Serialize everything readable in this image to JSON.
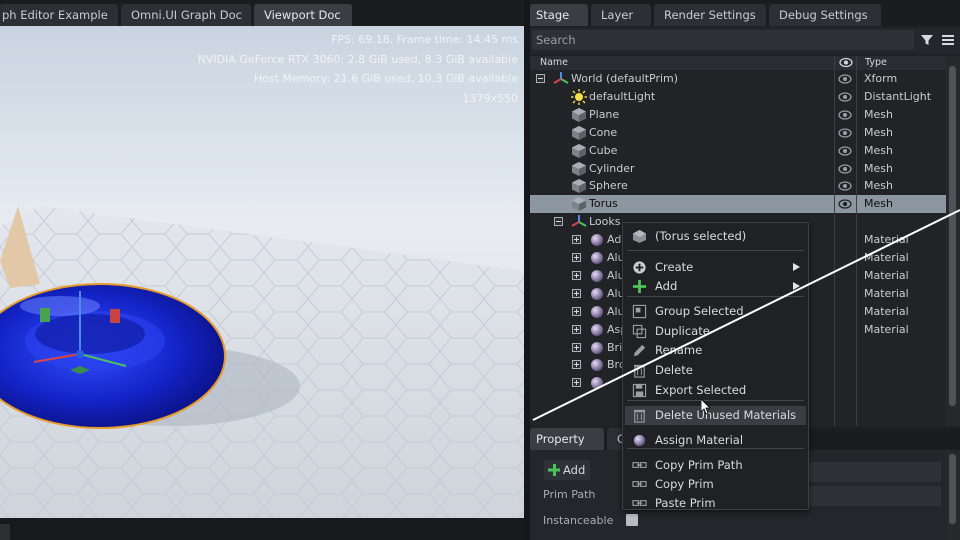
{
  "left_tabs": [
    "ph Editor Example",
    "Omni.UI Graph Doc",
    "Viewport Doc"
  ],
  "viewport": {
    "fps": "FPS: 69.18, Frame time: 14.45 ms",
    "gpu": "NVIDIA GeForce RTX 3060: 2.8 GiB used,  8.3 GiB available",
    "host": "Host Memory: 21.6 GiB used, 10.3 GiB available",
    "resolution": "1379x550"
  },
  "right_tabs": [
    "Stage",
    "Layer",
    "Render Settings",
    "Debug Settings"
  ],
  "search": {
    "placeholder": "Search"
  },
  "columns": {
    "name": "Name",
    "type": "Type"
  },
  "tree": [
    {
      "name": "World (defaultPrim)",
      "type": "Xform",
      "icon": "xform-icon",
      "indent": 0,
      "expander": "minus"
    },
    {
      "name": "defaultLight",
      "type": "DistantLight",
      "icon": "light-icon",
      "indent": 1
    },
    {
      "name": "Plane",
      "type": "Mesh",
      "icon": "mesh-icon",
      "indent": 1
    },
    {
      "name": "Cone",
      "type": "Mesh",
      "icon": "mesh-icon",
      "indent": 1
    },
    {
      "name": "Cube",
      "type": "Mesh",
      "icon": "mesh-icon",
      "indent": 1
    },
    {
      "name": "Cylinder",
      "type": "Mesh",
      "icon": "mesh-icon",
      "indent": 1
    },
    {
      "name": "Sphere",
      "type": "Mesh",
      "icon": "mesh-icon",
      "indent": 1
    },
    {
      "name": "Torus",
      "type": "Mesh",
      "icon": "mesh-icon",
      "indent": 1,
      "selected": true
    },
    {
      "name": "Looks",
      "type": "",
      "icon": "xform-icon",
      "indent": 1,
      "expander": "minus"
    },
    {
      "name": "Add",
      "type": "Material",
      "icon": "material-icon",
      "indent": 2,
      "expander": "plus"
    },
    {
      "name": "Alu",
      "type": "Material",
      "icon": "material-icon",
      "indent": 2,
      "expander": "plus"
    },
    {
      "name": "Alu",
      "type": "Material",
      "icon": "material-icon",
      "indent": 2,
      "expander": "plus"
    },
    {
      "name": "Alu",
      "type": "Material",
      "icon": "material-icon",
      "indent": 2,
      "expander": "plus"
    },
    {
      "name": "Alu",
      "type": "Material",
      "icon": "material-icon",
      "indent": 2,
      "expander": "plus"
    },
    {
      "name": "Asp",
      "type": "Material",
      "icon": "material-icon",
      "indent": 2,
      "expander": "plus"
    },
    {
      "name": "Bri",
      "type": "",
      "icon": "material-icon",
      "indent": 2,
      "expander": "plus"
    },
    {
      "name": "Bro",
      "type": "",
      "icon": "material-icon",
      "indent": 2,
      "expander": "plus"
    },
    {
      "name": "",
      "type": "",
      "icon": "material-icon",
      "indent": 2,
      "expander": "plus"
    }
  ],
  "property": {
    "tabs": [
      "Property",
      "C"
    ],
    "add_label": "Add",
    "prim_path_label": "Prim Path",
    "instanceable_label": "Instanceable"
  },
  "context_menu": {
    "header": "(Torus selected)",
    "items": [
      {
        "label": "Create",
        "icon": "plus-circle-icon",
        "submenu": true
      },
      {
        "label": "Add",
        "icon": "plus-icon",
        "submenu": true
      },
      {
        "label": "Group Selected",
        "icon": "group-icon"
      },
      {
        "label": "Duplicate",
        "icon": "duplicate-icon"
      },
      {
        "label": "Rename",
        "icon": "pencil-icon"
      },
      {
        "label": "Delete",
        "icon": "trash-icon"
      },
      {
        "label": "Export Selected",
        "icon": "save-icon"
      },
      {
        "label": "Delete Unused Materials",
        "icon": "trash-icon",
        "hover": true
      },
      {
        "label": "Assign Material",
        "icon": "material-icon"
      },
      {
        "label": "Copy Prim Path",
        "icon": "link-icon"
      },
      {
        "label": "Copy Prim",
        "icon": "link-icon"
      },
      {
        "label": "Paste Prim",
        "icon": "link-icon"
      }
    ]
  },
  "colors": {
    "selection": "#8d97a2",
    "torus": "#1a32d8",
    "highlight_outline": "#e69a2a"
  }
}
